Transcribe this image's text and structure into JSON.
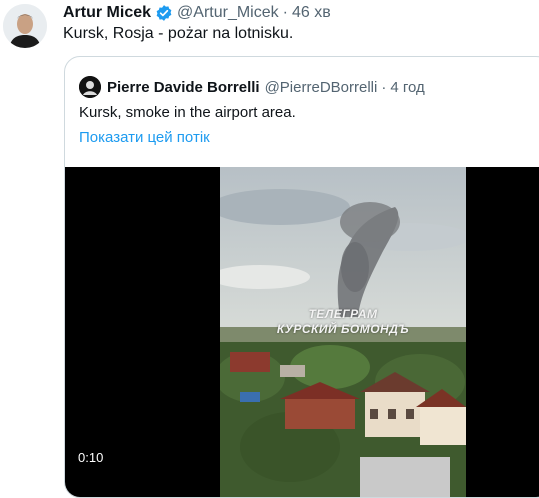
{
  "tweet": {
    "author_name": "Artur Micek",
    "handle": "@Artur_Micek",
    "separator": "·",
    "time": "46 хв",
    "text": "Kursk, Rosja - pożar na lotnisku."
  },
  "quoted_tweet": {
    "author_name": "Pierre Davide Borrelli",
    "handle": "@PierreDBorrelli",
    "separator": "·",
    "time": "4 год",
    "text": "Kursk, smoke in the airport area.",
    "show_thread_label": "Показати цей потік"
  },
  "video": {
    "duration": "0:10",
    "watermark_line1": "ТЕЛЕГРАМ",
    "watermark_line2": "КУРСКИЙ БОМОНДЪ"
  },
  "colors": {
    "link": "#1d9bf0",
    "verified": "#1d9bf0",
    "secondary_text": "#536471"
  },
  "icons": {
    "verified": "verified-badge-icon"
  }
}
